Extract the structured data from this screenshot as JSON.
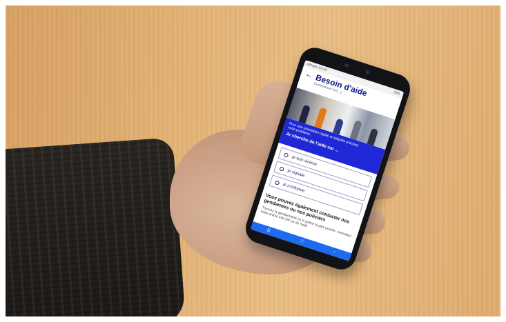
{
  "status_bar": {
    "left": "Afrique 14:20",
    "right": "83%"
  },
  "app": {
    "title": "Besoin d'aide",
    "subtitle": "Commencer ici/(...)"
  },
  "banner": {
    "line1": "Pour une orientation rapide et adaptée précisez",
    "line2": "votre problème.",
    "prompt": "Je cherche de l'aide car ..."
  },
  "options": [
    {
      "label": "je suis victime"
    },
    {
      "label": "je signale"
    },
    {
      "label": "je m'informe"
    }
  ],
  "contact": {
    "heading": "Vous pouvez également contacter nos gendarmes ou nos policiers",
    "body": "Trouvez la gendarmerie ou la police la plus proche, consultez notre article Info-DP ou de l'aide"
  },
  "icons": {
    "back": "back-arrow-icon",
    "nav_recent": "recent-apps-icon",
    "nav_home": "home-icon",
    "nav_back": "back-icon"
  },
  "colors": {
    "brand_blue": "#1f27d6",
    "title_blue": "#0b1a8c",
    "nav_blue": "#1f6bf0"
  }
}
